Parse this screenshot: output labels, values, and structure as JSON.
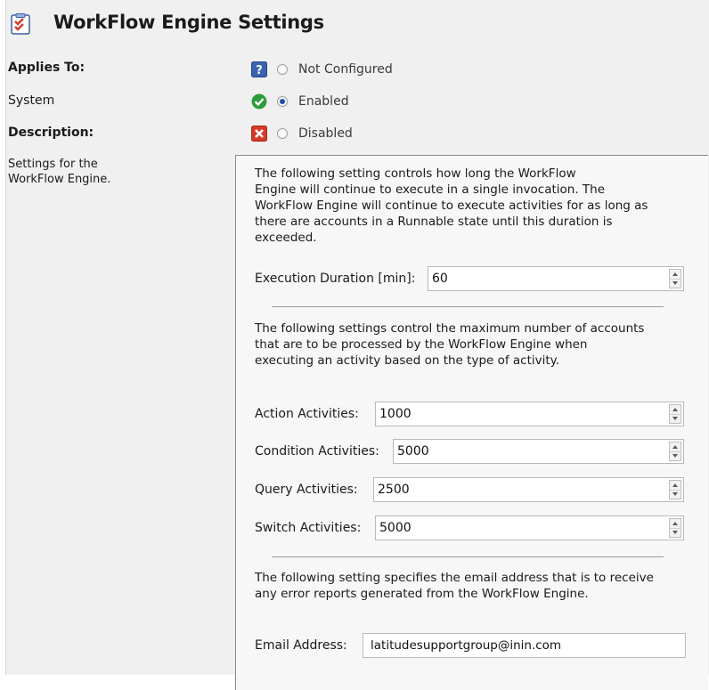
{
  "header": {
    "title": "WorkFlow Engine Settings",
    "icon": "checklist-icon"
  },
  "left": {
    "applies_to_label": "Applies To:",
    "applies_to_value": "System",
    "description_label": "Description:",
    "description_value": "Settings for the WorkFlow Engine."
  },
  "states": {
    "selected": "Enabled",
    "options": [
      {
        "label": "Not Configured",
        "icon": "question-icon",
        "color": "#3a62b0"
      },
      {
        "label": "Enabled",
        "icon": "check-circle-icon",
        "color": "#2f9e3a"
      },
      {
        "label": "Disabled",
        "icon": "error-x-icon",
        "color": "#d43a2a"
      }
    ]
  },
  "panel": {
    "intro_lines": [
      "The following setting controls how long the WorkFlow",
      "Engine will continue to execute in a single invocation.  The",
      "WorkFlow Engine will continue to execute activities for as long as",
      "there are accounts in a Runnable state until this duration is",
      "exceeded."
    ],
    "execution_duration": {
      "label": "Execution Duration [min]:",
      "value": "60"
    },
    "activities_lines": [
      "The following settings control the maximum number of accounts",
      "that are to be processed by the WorkFlow Engine when",
      "executing an activity based on the type of activity."
    ],
    "action": {
      "label": "Action Activities:",
      "value": "1000"
    },
    "condition": {
      "label": "Condition Activities:",
      "value": "5000"
    },
    "query": {
      "label": "Query Activities:",
      "value": "2500"
    },
    "switch": {
      "label": "Switch Activities:",
      "value": "5000"
    },
    "email_lines": [
      "The following setting specifies the email address that is to receive",
      "any error reports generated from the WorkFlow Engine."
    ],
    "email": {
      "label": "Email Address:",
      "value": "latitudesupportgroup@inin.com"
    }
  }
}
